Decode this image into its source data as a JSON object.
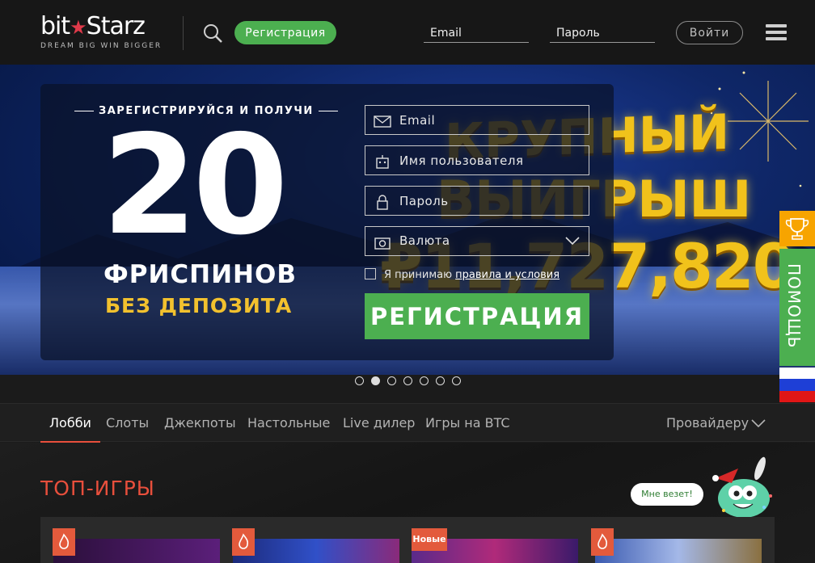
{
  "brand": {
    "logo_name": "bitStarz",
    "logo_part1": "bit",
    "logo_part2": "Starz",
    "tagline": "DREAM BIG  WIN BIGGER",
    "accent_green": "#4caf50",
    "accent_red": "#e84f3c",
    "accent_gold": "#f2c12e"
  },
  "header": {
    "register_label": "Регистрация",
    "email_placeholder": "Email",
    "password_placeholder": "Пароль",
    "login_label": "Войти",
    "icons": [
      "search-icon",
      "menu-icon"
    ]
  },
  "banner": {
    "promo_heading": "ЗАРЕГИСТРИРУЙСЯ И ПОЛУЧИ",
    "promo_number": "20",
    "promo_line1": "ФРИСПИНОВ",
    "promo_line2": "БЕЗ ДЕПОЗИТА",
    "jackpot_line1": "КРУПНЫЙ",
    "jackpot_line2": "ВЫИГРЫШ",
    "jackpot_amount": "₽11,727,820",
    "form": {
      "email_placeholder": "Email",
      "username_placeholder": "Имя пользователя",
      "password_placeholder": "Пароль",
      "currency_label": "Валюта",
      "terms_prefix": "Я принимаю",
      "terms_link": "правила и условия",
      "submit_label": "РЕГИСТРАЦИЯ"
    },
    "slides_total": 7,
    "active_slide": 2
  },
  "side": {
    "help_label": "ПОМОЩЬ",
    "icons": [
      "trophy-icon",
      "russia-flag-icon"
    ]
  },
  "nav": {
    "tabs": [
      {
        "label": "Лобби",
        "active": true
      },
      {
        "label": "Слоты",
        "active": false
      },
      {
        "label": "Джекпоты",
        "active": false
      },
      {
        "label": "Настольные",
        "active": false
      },
      {
        "label": "Live дилер",
        "active": false
      },
      {
        "label": "Игры на BTC",
        "active": false
      }
    ],
    "providers_label": "Провайдеру"
  },
  "content": {
    "section_title": "ТОП-ИГРЫ",
    "mascot_speech": "Мне везет!",
    "new_badge": "Новые",
    "game_badges": [
      "hot-icon",
      "hot-icon",
      "new",
      "hot-icon"
    ]
  }
}
